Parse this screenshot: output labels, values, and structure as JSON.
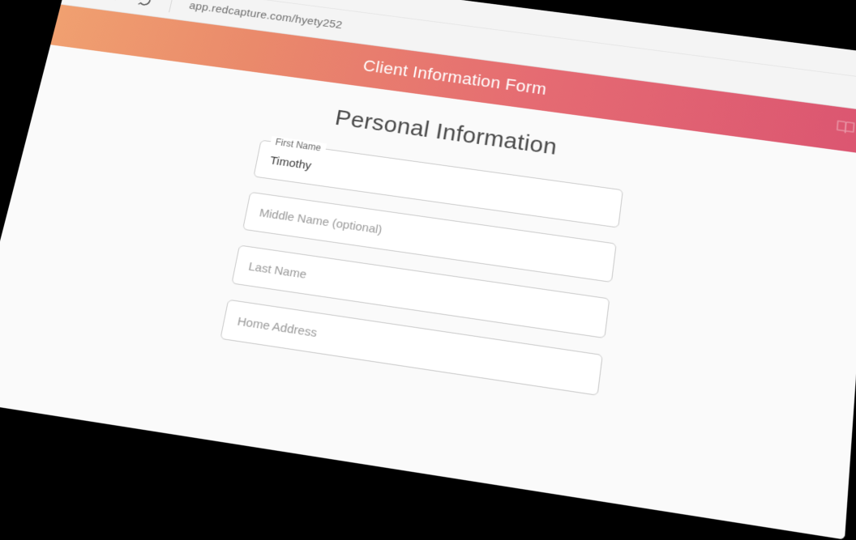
{
  "browser": {
    "url": "app.redcapture.com/hyety252"
  },
  "banner": {
    "title": "Client Information Form"
  },
  "form": {
    "section_title": "Personal Information",
    "fields": {
      "first_name": {
        "label": "First Name",
        "value": "Timothy"
      },
      "middle_name": {
        "placeholder": "Middle Name (optional)"
      },
      "last_name": {
        "placeholder": "Last Name"
      },
      "home_address": {
        "placeholder": "Home Address"
      }
    }
  }
}
